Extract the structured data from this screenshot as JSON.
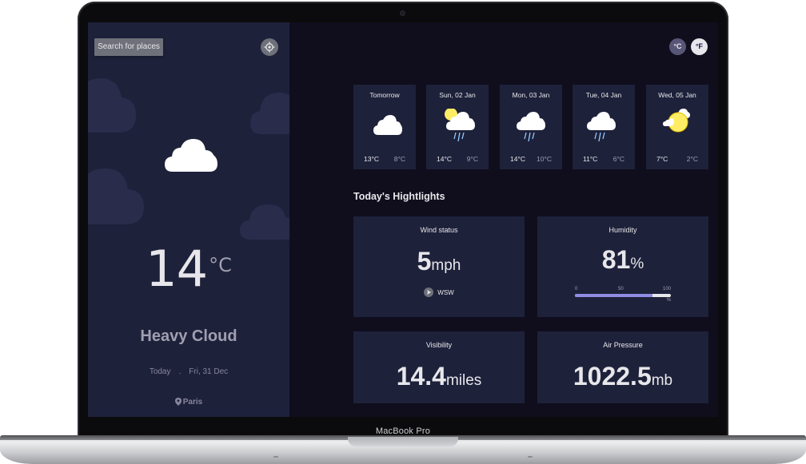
{
  "device": {
    "label": "MacBook Pro"
  },
  "sidebar": {
    "search_label": "Search for places",
    "locate_icon": "crosshair-icon",
    "weather_icon": "cloud-icon",
    "temperature": "14",
    "temperature_unit": "°C",
    "condition": "Heavy Cloud",
    "date_prefix": "Today",
    "date_separator": ".",
    "date": "Fri, 31 Dec",
    "location": "Paris"
  },
  "units": {
    "celsius": "°C",
    "fahrenheit": "°F",
    "active": "celsius"
  },
  "forecast": [
    {
      "day": "Tomorrow",
      "icon": "cloud",
      "high": "13°C",
      "low": "8°C"
    },
    {
      "day": "Sun, 02 Jan",
      "icon": "sun-rain",
      "high": "14°C",
      "low": "9°C"
    },
    {
      "day": "Mon, 03 Jan",
      "icon": "rain",
      "high": "14°C",
      "low": "10°C"
    },
    {
      "day": "Tue, 04 Jan",
      "icon": "rain",
      "high": "11°C",
      "low": "6°C"
    },
    {
      "day": "Wed, 05 Jan",
      "icon": "sun-cloud",
      "high": "7°C",
      "low": "2°C"
    }
  ],
  "highlights": {
    "title": "Today's Hightlights",
    "wind": {
      "label": "Wind status",
      "value": "5",
      "unit": "mph",
      "direction": "WSW"
    },
    "humidity": {
      "label": "Humidity",
      "value": "81",
      "unit": "%",
      "level": 81,
      "scale": [
        "0",
        "50",
        "100"
      ],
      "scale_unit": "%"
    },
    "visibility": {
      "label": "Visibility",
      "value": "14.4",
      "unit": "miles"
    },
    "pressure": {
      "label": "Air Pressure",
      "value": "1022.5",
      "unit": "mb"
    }
  },
  "colors": {
    "sidebar_bg": "#1e213a",
    "main_bg": "#100e1d",
    "card_bg": "#1e213a",
    "accent": "#8e8ce3",
    "sun": "#ffec65",
    "text": "#e7e7eb"
  }
}
